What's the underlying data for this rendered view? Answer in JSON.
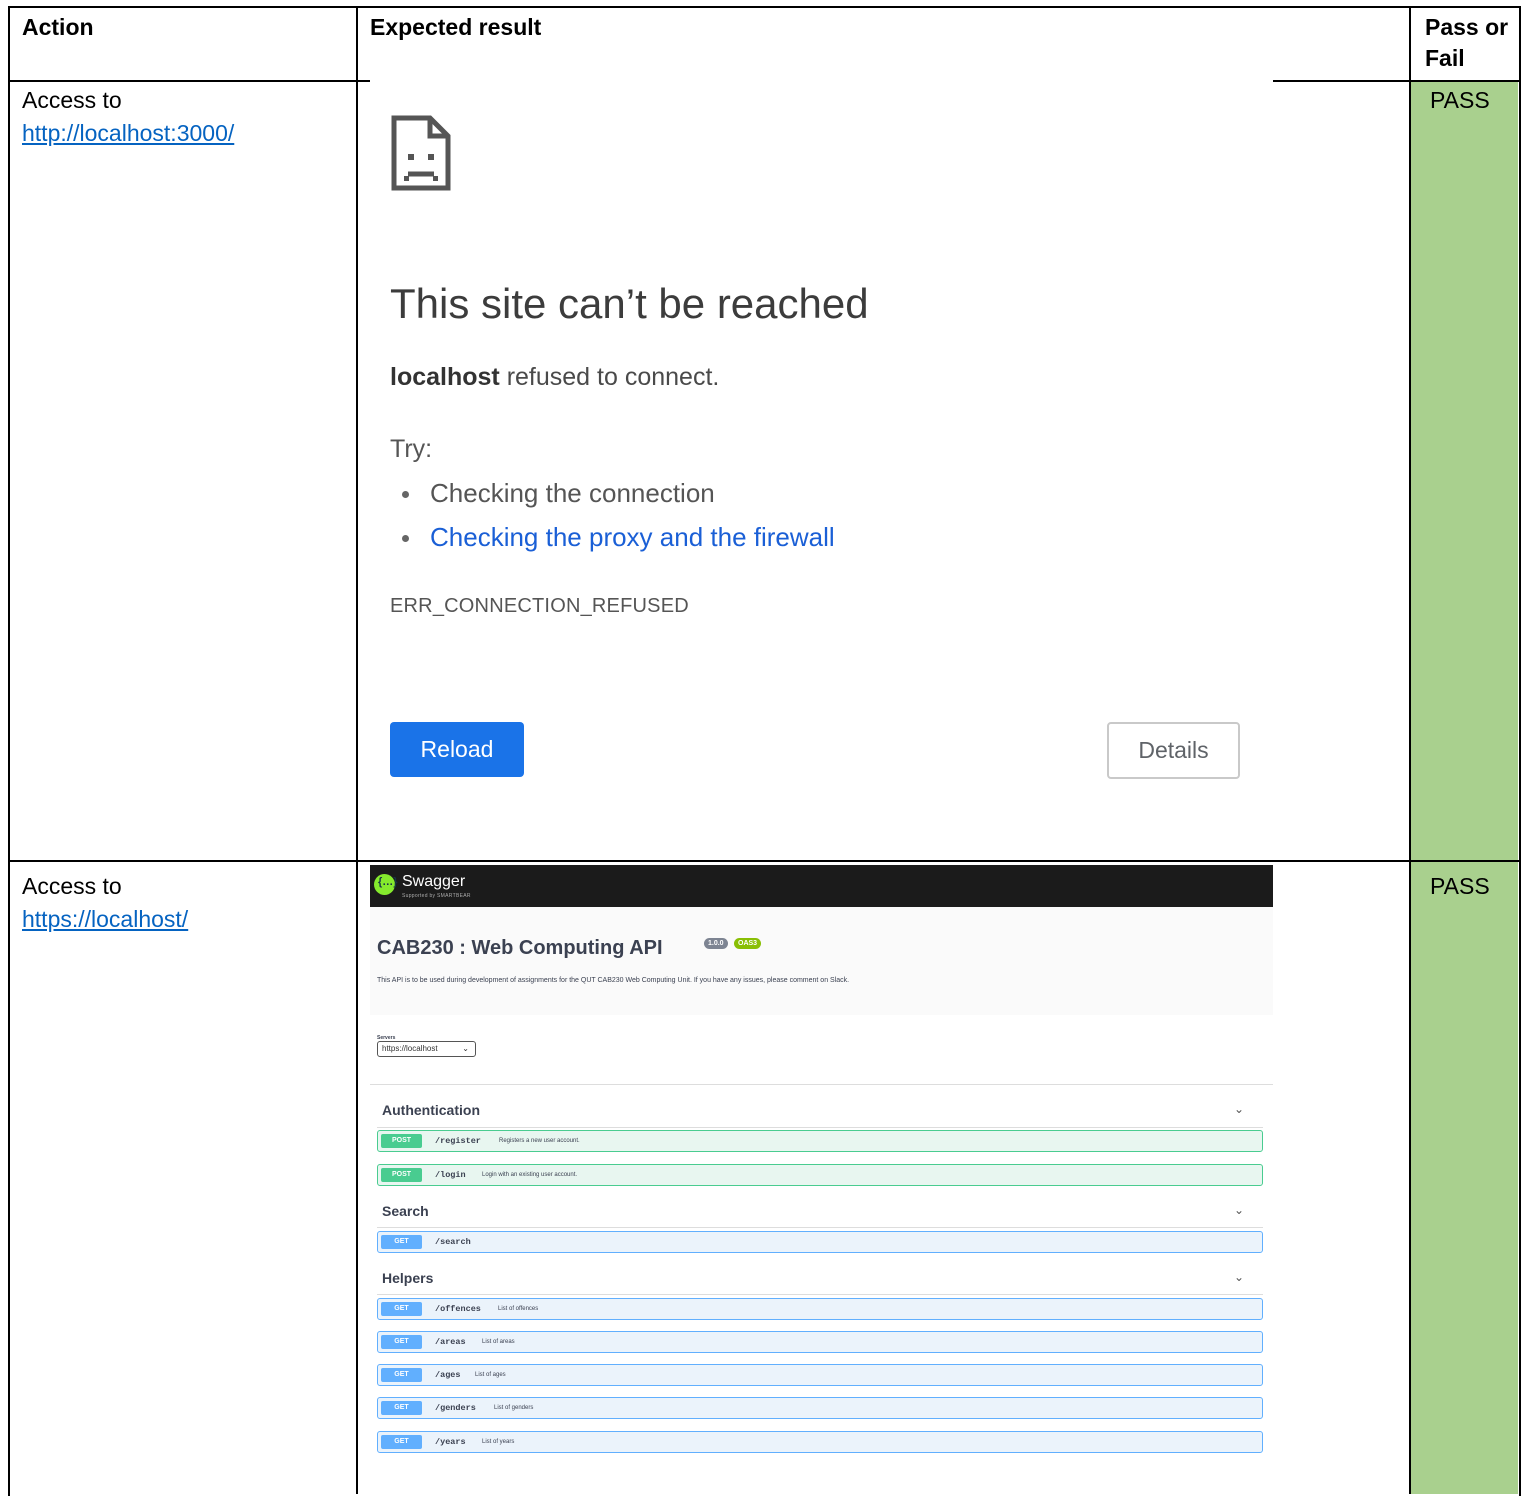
{
  "headers": {
    "action": "Action",
    "expected": "Expected result",
    "result": "Pass or Fail"
  },
  "rows": [
    {
      "action_text": "Access to",
      "action_link": "http://localhost:3000/",
      "result": "PASS",
      "error_page": {
        "title": "This site can’t be reached",
        "host": "localhost",
        "message": " refused to connect.",
        "try_label": "Try:",
        "suggestions": [
          "Checking the connection",
          "Checking the proxy and the firewall"
        ],
        "error_code": "ERR_CONNECTION_REFUSED",
        "reload_label": "Reload",
        "details_label": "Details"
      }
    },
    {
      "action_text": "Access to",
      "action_link": "https://localhost/",
      "result": "PASS",
      "swagger": {
        "brand": "Swagger",
        "brand_sub": "Supported by SMARTBEAR",
        "title": "CAB230 : Web Computing API",
        "version_badge": "1.0.0",
        "oas_badge": "OAS3",
        "description": "This API is to be used during development of assignments for the QUT CAB230 Web Computing Unit. If you have any issues, please comment on Slack.",
        "servers_label": "Servers",
        "server_value": "https://localhost",
        "sections": [
          {
            "name": "Authentication"
          },
          {
            "name": "Search"
          },
          {
            "name": "Helpers"
          }
        ],
        "ops": [
          {
            "method": "POST",
            "path": "/register",
            "desc": "Registers a new user account."
          },
          {
            "method": "POST",
            "path": "/login",
            "desc": "Login with an existing user account."
          },
          {
            "method": "GET",
            "path": "/search",
            "desc": ""
          },
          {
            "method": "GET",
            "path": "/offences",
            "desc": "List of offences"
          },
          {
            "method": "GET",
            "path": "/areas",
            "desc": "List of areas"
          },
          {
            "method": "GET",
            "path": "/ages",
            "desc": "List of ages"
          },
          {
            "method": "GET",
            "path": "/genders",
            "desc": "List of genders"
          },
          {
            "method": "GET",
            "path": "/years",
            "desc": "List of years"
          }
        ]
      }
    }
  ],
  "colors": {
    "pass_fill": "#a9d08e",
    "link": "#0563c1",
    "reload_blue": "#1a73e8",
    "post_green": "#49cc90",
    "get_blue": "#61affe"
  }
}
